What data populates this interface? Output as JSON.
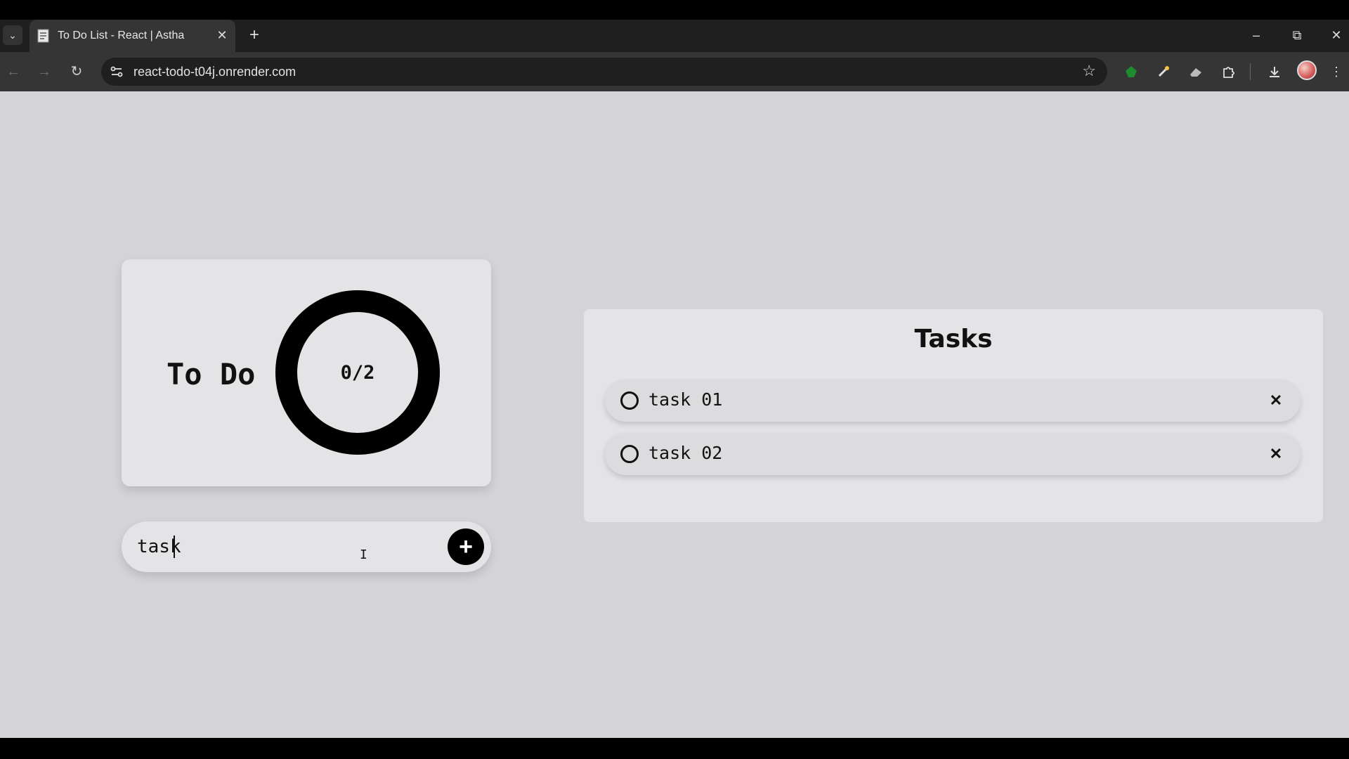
{
  "browser": {
    "tab_title": "To Do List - React | Astha",
    "url": "react-todo-t04j.onrender.com",
    "icons": {
      "tab_list": "chevron-down-icon",
      "favicon": "document-icon",
      "tab_close": "close-icon",
      "new_tab": "plus-icon",
      "back": "arrow-left-icon",
      "forward": "arrow-right-icon",
      "reload": "reload-icon",
      "site_info": "tune-icon",
      "bookmark": "star-icon",
      "extensions": [
        "green-extension-icon",
        "color-picker-icon",
        "eraser-icon",
        "puzzle-icon"
      ],
      "downloads": "download-icon",
      "menu": "kebab-menu-icon"
    }
  },
  "app": {
    "summary": {
      "title": "To Do",
      "progress_text": "0/2",
      "completed": 0,
      "total": 2
    },
    "input": {
      "value": "task"
    },
    "tasks_panel": {
      "title": "Tasks",
      "tasks": [
        {
          "label": "task 01",
          "done": false
        },
        {
          "label": "task 02",
          "done": false
        }
      ]
    }
  },
  "colors": {
    "page_background": "#d3d3d8",
    "card_background": "#e4e4e6",
    "accent": "#000000"
  }
}
